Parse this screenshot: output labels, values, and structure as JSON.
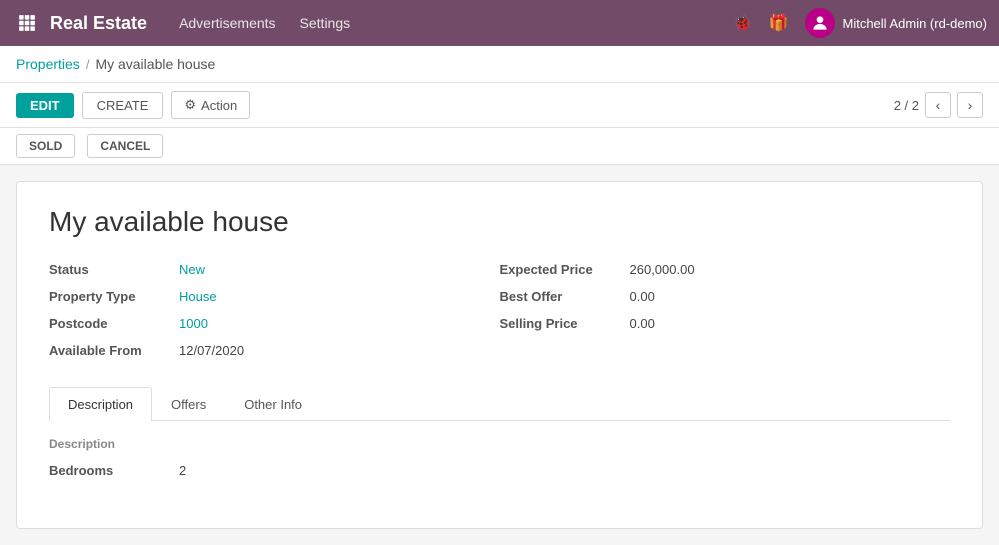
{
  "topnav": {
    "brand": "Real Estate",
    "menu": [
      {
        "label": "Advertisements"
      },
      {
        "label": "Settings"
      }
    ],
    "user_label": "Mitchell Admin (rd-demo)"
  },
  "breadcrumb": {
    "parent_label": "Properties",
    "separator": "/",
    "current_label": "My available house"
  },
  "toolbar": {
    "edit_label": "EDIT",
    "create_label": "CREATE",
    "action_label": "Action",
    "pager_text": "2 / 2"
  },
  "status_actions": {
    "sold_label": "SOLD",
    "cancel_label": "CANCEL"
  },
  "record": {
    "title": "My available house",
    "fields_left": [
      {
        "label": "Status",
        "value": "New",
        "colored": true
      },
      {
        "label": "Property Type",
        "value": "House",
        "colored": true
      },
      {
        "label": "Postcode",
        "value": "1000",
        "colored": true
      },
      {
        "label": "Available From",
        "value": "12/07/2020",
        "colored": false
      }
    ],
    "fields_right": [
      {
        "label": "Expected Price",
        "value": "260,000.00",
        "colored": false
      },
      {
        "label": "Best Offer",
        "value": "0.00",
        "colored": false
      },
      {
        "label": "Selling Price",
        "value": "0.00",
        "colored": false
      }
    ]
  },
  "tabs": [
    {
      "label": "Description",
      "active": true
    },
    {
      "label": "Offers",
      "active": false
    },
    {
      "label": "Other Info",
      "active": false
    }
  ],
  "tab_description": {
    "section_label": "Description",
    "fields": [
      {
        "label": "Bedrooms",
        "value": "2"
      }
    ]
  }
}
